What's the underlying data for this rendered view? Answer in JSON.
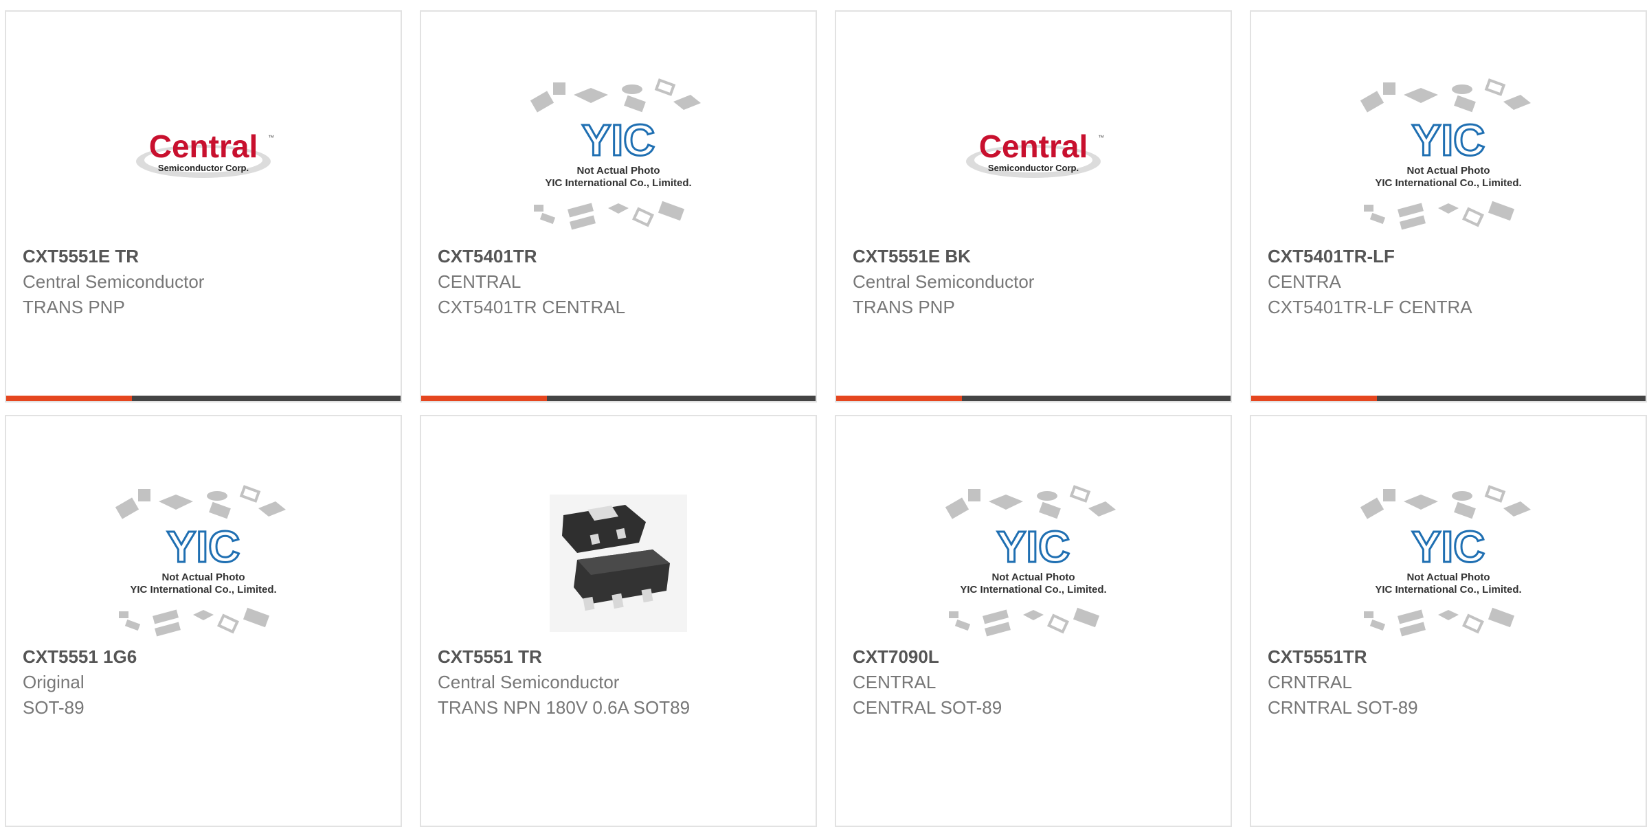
{
  "products": [
    {
      "part_number": "CXT5551E TR",
      "manufacturer": "Central Semiconductor",
      "description": "TRANS PNP",
      "image": "central-logo"
    },
    {
      "part_number": "CXT5401TR",
      "manufacturer": "CENTRAL",
      "description": "CXT5401TR CENTRAL",
      "image": "yic-placeholder"
    },
    {
      "part_number": "CXT5551E BK",
      "manufacturer": "Central Semiconductor",
      "description": "TRANS PNP",
      "image": "central-logo"
    },
    {
      "part_number": "CXT5401TR-LF",
      "manufacturer": "CENTRA",
      "description": "CXT5401TR-LF CENTRA",
      "image": "yic-placeholder"
    },
    {
      "part_number": "CXT5551 1G6",
      "manufacturer": "Original",
      "description": "SOT-89",
      "image": "yic-placeholder"
    },
    {
      "part_number": "CXT5551 TR",
      "manufacturer": "Central Semiconductor",
      "description": "TRANS NPN 180V 0.6A SOT89",
      "image": "sot89-package-photo"
    },
    {
      "part_number": "CXT7090L",
      "manufacturer": "CENTRAL",
      "description": "CENTRAL SOT-89",
      "image": "yic-placeholder"
    },
    {
      "part_number": "CXT5551TR",
      "manufacturer": "CRNTRAL",
      "description": "CRNTRAL SOT-89",
      "image": "yic-placeholder"
    }
  ],
  "central_logo": {
    "brand": "Central",
    "trademark": "™",
    "sub": "Semiconductor Corp."
  },
  "yic_placeholder": {
    "brand": "YIC",
    "line1": "Not Actual Photo",
    "line2": "YIC International Co., Limited."
  },
  "colors": {
    "accent": "#e5461f",
    "bar": "#444444",
    "logo_red": "#c8102e",
    "yic_blue": "#1f6fb2"
  }
}
